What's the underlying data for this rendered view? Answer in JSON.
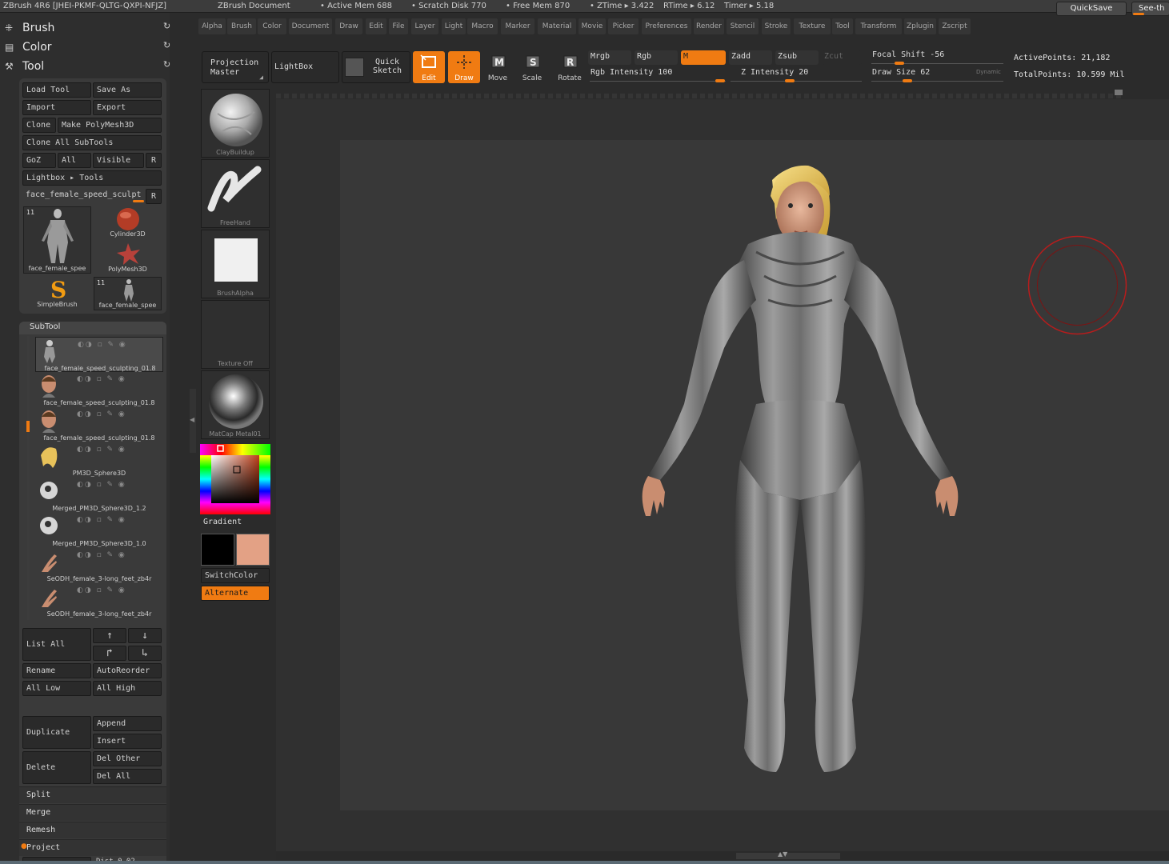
{
  "titlebar": {
    "app": "ZBrush 4R6 [JHEI-PKMF-QLTG-QXPI-NFJZ]",
    "doc": "ZBrush Document",
    "active_mem": "• Active Mem 688",
    "scratch": "• Scratch Disk 770",
    "free_mem": "• Free Mem 870",
    "ztime": "• ZTime ▸ 3.422",
    "rtime": "RTime ▸ 6.12",
    "timer": "Timer ▸ 5.18",
    "quicksave": "QuickSave",
    "seethrough": "See-th"
  },
  "menu": [
    "Alpha",
    "Brush",
    "Color",
    "Document",
    "Draw",
    "Edit",
    "File",
    "Layer",
    "Light",
    "Macro",
    "Marker",
    "Material",
    "Movie",
    "Picker",
    "Preferences",
    "Render",
    "Stencil",
    "Stroke",
    "Texture",
    "Tool",
    "Transform",
    "Zplugin",
    "Zscript"
  ],
  "palettes": {
    "brush": "Brush",
    "color": "Color",
    "tool": "Tool"
  },
  "tool": {
    "load": "Load Tool",
    "saveas": "Save As",
    "import": "Import",
    "export": "Export",
    "clone": "Clone",
    "polymesh": "Make PolyMesh3D",
    "cloneall": "Clone All SubTools",
    "goz": "GoZ",
    "all": "All",
    "visible": "Visible",
    "r": "R",
    "lightbox": "Lightbox ▸ Tools",
    "current": "face_female_speed_sculpt",
    "current_r": "R",
    "thumbs": [
      {
        "name": "face_female_spee",
        "count": "11"
      },
      {
        "name": "Cylinder3D"
      },
      {
        "name": "PolyMesh3D"
      },
      {
        "name": "SimpleBrush"
      },
      {
        "name": "face_female_spee",
        "count": "11"
      }
    ]
  },
  "subtool": {
    "title": "SubTool",
    "items": [
      "face_female_speed_sculpting_01.8",
      "face_female_speed_sculpting_01.8",
      "face_female_speed_sculpting_01.8",
      "PM3D_Sphere3D",
      "Merged_PM3D_Sphere3D_1.2",
      "Merged_PM3D_Sphere3D_1.0",
      "SeODH_female_3-long_feet_zb4r",
      "SeODH_female_3-long_feet_zb4r"
    ],
    "listall": "List All",
    "rename": "Rename",
    "autoreorder": "AutoReorder",
    "alllow": "All Low",
    "allhigh": "All High",
    "duplicate": "Duplicate",
    "append": "Append",
    "insert": "Insert",
    "delete": "Delete",
    "delother": "Del Other",
    "delall": "Del All",
    "split": "Split",
    "merge": "Merge",
    "remesh": "Remesh",
    "project": "Project",
    "dist": "Dist 0.02"
  },
  "shelf": {
    "projection_master": "Projection Master",
    "lightbox": "LightBox",
    "quick_sketch": "Quick Sketch",
    "edit": "Edit",
    "draw": "Draw",
    "move": "Move",
    "scale": "Scale",
    "rotate": "Rotate",
    "mrgb": "Mrgb",
    "rgb": "Rgb",
    "m": "M",
    "zadd": "Zadd",
    "zsub": "Zsub",
    "zcut": "Zcut",
    "rgb_intensity": "Rgb Intensity 100",
    "z_intensity": "Z Intensity 20",
    "focal_shift": "Focal Shift -56",
    "draw_size": "Draw Size 62",
    "dynamic": "Dynamic",
    "active_points": "ActivePoints: 21,182",
    "total_points": "TotalPoints: 10.599 Mil"
  },
  "tray": {
    "brush": "ClayBuildup",
    "stroke": "FreeHand",
    "alpha": "BrushAlpha",
    "texture": "Texture Off",
    "material": "MatCap Metal01",
    "gradient": "Gradient",
    "switchcolor": "SwitchColor",
    "alternate": "Alternate"
  },
  "colors": {
    "accent": "#f07b12",
    "main_color": "#000000",
    "secondary_color": "#e3a185",
    "cursor_ring": "#b81c1c"
  }
}
